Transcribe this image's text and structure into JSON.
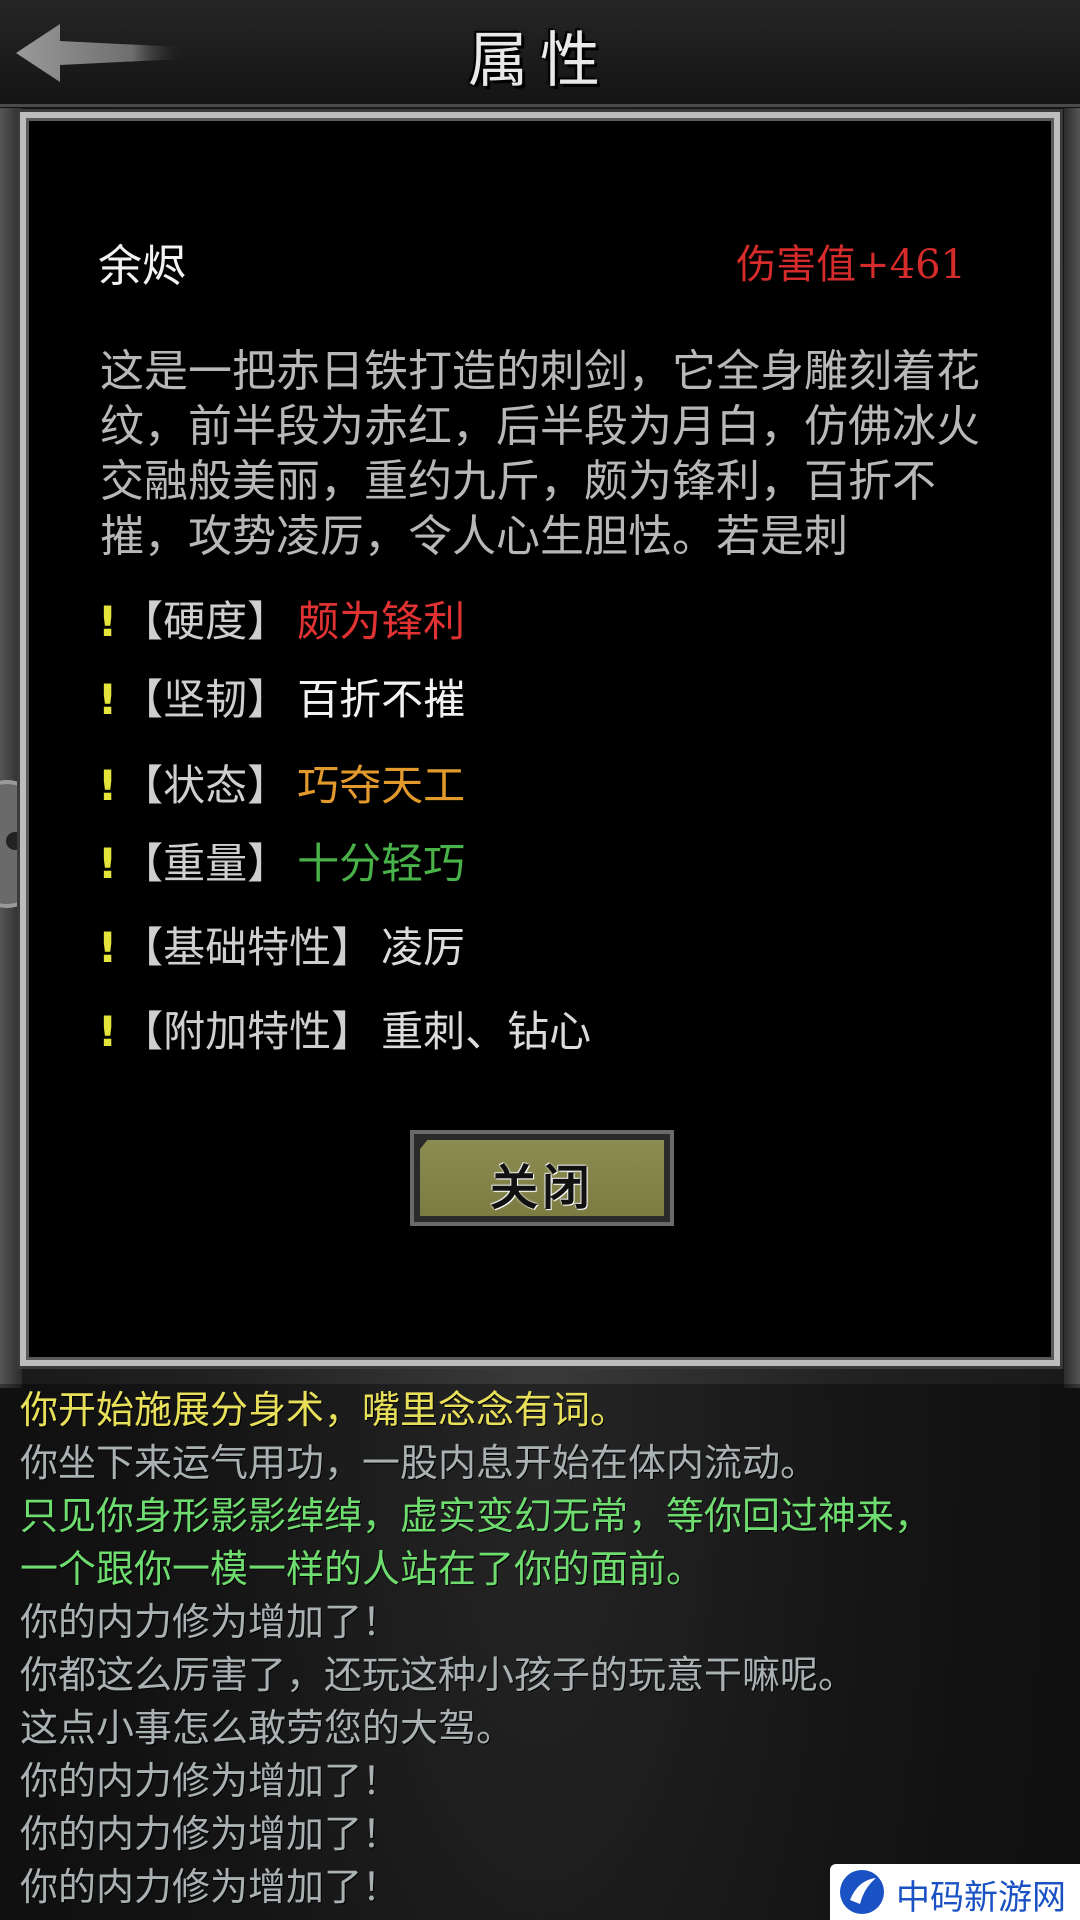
{
  "header": {
    "title": "属性"
  },
  "item": {
    "name": "余烬",
    "damage": "伤害值+461",
    "description": "这是一把赤日铁打造的刺剑，它全身雕刻着花纹，前半段为赤红，后半段为月白，仿佛冰火交融般美丽，重约九斤，颇为锋利，百折不摧，攻势凌厉，令人心生胆怯。若是刺"
  },
  "attributes": [
    {
      "mark": "!",
      "key": "【硬度】",
      "value": "颇为锋利",
      "color": "#e03232"
    },
    {
      "mark": "!",
      "key": "【坚韧】",
      "value": "百折不摧",
      "color": "#f2f2f2"
    },
    {
      "mark": "!",
      "key": "【状态】",
      "value": "巧夺天工",
      "color": "#e29a2c"
    },
    {
      "mark": "!",
      "key": "【重量】",
      "value": "十分轻巧",
      "color": "#49b34a"
    },
    {
      "mark": "!",
      "key": "【基础特性】",
      "value": "凌厉",
      "color": "#dcdcdc"
    },
    {
      "mark": "!",
      "key": "【附加特性】",
      "value": "重刺、钻心",
      "color": "#dcdcdc"
    }
  ],
  "close_button": {
    "label": "关闭"
  },
  "log": [
    {
      "text": "你开始施展分身术，嘴里念念有词。",
      "color": "#e8e05a"
    },
    {
      "text": "你坐下来运气用功，一股内息开始在体内流动。",
      "color": "#a9b1b3"
    },
    {
      "text": "只见你身形影影绰绰，虚实变幻无常，等你回过神来，",
      "color": "#6fdc6f"
    },
    {
      "text": "一个跟你一模一样的人站在了你的面前。",
      "color": "#6fdc6f"
    },
    {
      "text": "你的内力修为增加了！",
      "color": "#a9b1b3"
    },
    {
      "text": "你都这么厉害了，还玩这种小孩子的玩意干嘛呢。",
      "color": "#a9b1b3"
    },
    {
      "text": "这点小事怎么敢劳您的大驾。",
      "color": "#a9b1b3"
    },
    {
      "text": "你的内力修为增加了！",
      "color": "#a9b1b3"
    },
    {
      "text": "你的内力修为增加了！",
      "color": "#a9b1b3"
    },
    {
      "text": "你的内力修为增加了！",
      "color": "#a9b1b3"
    }
  ],
  "watermark": {
    "text": "中码新游网"
  }
}
